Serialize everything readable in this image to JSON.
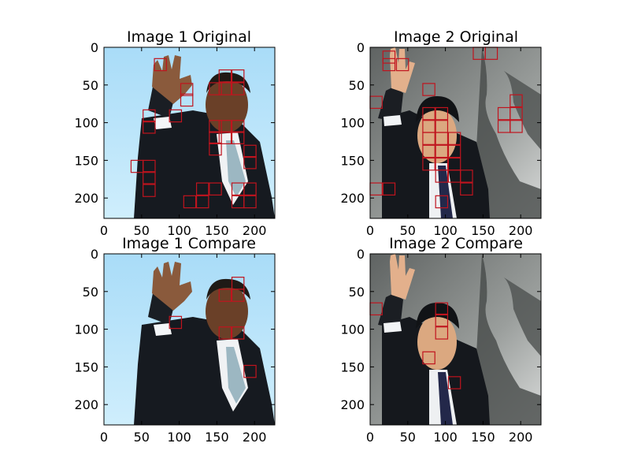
{
  "chart_data": [
    {
      "type": "image",
      "title": "Image 1 Original",
      "xticks": [
        0,
        50,
        100,
        150,
        200
      ],
      "yticks": [
        0,
        50,
        100,
        150,
        200
      ],
      "xlim": [
        0,
        227
      ],
      "ylim": [
        227,
        0
      ],
      "image_subject": "Barack Obama waving, light blue background",
      "background_color": "#bfe6fa",
      "box_color": "#c0141e",
      "box_size": 16,
      "boxes": [
        [
          67,
          15
        ],
        [
          102,
          48
        ],
        [
          102,
          62
        ],
        [
          87,
          83
        ],
        [
          52,
          83
        ],
        [
          52,
          98
        ],
        [
          140,
          47
        ],
        [
          153,
          47
        ],
        [
          170,
          47
        ],
        [
          153,
          30
        ],
        [
          170,
          30
        ],
        [
          140,
          97
        ],
        [
          140,
          112
        ],
        [
          140,
          127
        ],
        [
          153,
          97
        ],
        [
          153,
          112
        ],
        [
          170,
          97
        ],
        [
          170,
          112
        ],
        [
          186,
          130
        ],
        [
          186,
          145
        ],
        [
          36,
          150
        ],
        [
          52,
          150
        ],
        [
          52,
          165
        ],
        [
          52,
          182
        ],
        [
          123,
          180
        ],
        [
          140,
          180
        ],
        [
          123,
          197
        ],
        [
          106,
          197
        ],
        [
          170,
          180
        ],
        [
          186,
          180
        ],
        [
          170,
          197
        ],
        [
          186,
          197
        ]
      ]
    },
    {
      "type": "image",
      "title": "Image 2 Original",
      "xticks": [
        0,
        50,
        100,
        150,
        200
      ],
      "yticks": [
        0,
        50,
        100,
        150,
        200
      ],
      "xlim": [
        0,
        227
      ],
      "ylim": [
        227,
        0
      ],
      "image_subject": "Shinzo Abe waving, grey background with shadow",
      "background_color": "#8e9290",
      "box_color": "#c0141e",
      "box_size": 16,
      "boxes": [
        [
          17,
          5
        ],
        [
          17,
          15
        ],
        [
          35,
          15
        ],
        [
          137,
          0
        ],
        [
          153,
          0
        ],
        [
          0,
          65
        ],
        [
          70,
          48
        ],
        [
          70,
          80
        ],
        [
          70,
          97
        ],
        [
          87,
          80
        ],
        [
          87,
          97
        ],
        [
          70,
          113
        ],
        [
          70,
          130
        ],
        [
          87,
          113
        ],
        [
          87,
          130
        ],
        [
          104,
          113
        ],
        [
          104,
          130
        ],
        [
          70,
          147
        ],
        [
          87,
          147
        ],
        [
          104,
          147
        ],
        [
          104,
          163
        ],
        [
          87,
          163
        ],
        [
          120,
          163
        ],
        [
          120,
          180
        ],
        [
          0,
          180
        ],
        [
          17,
          180
        ],
        [
          87,
          197
        ],
        [
          170,
          80
        ],
        [
          186,
          80
        ],
        [
          170,
          97
        ],
        [
          186,
          97
        ],
        [
          186,
          63
        ]
      ]
    },
    {
      "type": "image",
      "title": "Image 1 Compare",
      "xticks": [
        0,
        50,
        100,
        150,
        200
      ],
      "yticks": [
        0,
        50,
        100,
        150,
        200
      ],
      "xlim": [
        0,
        227
      ],
      "ylim": [
        227,
        0
      ],
      "image_subject": "Barack Obama waving, light blue background",
      "background_color": "#bfe6fa",
      "box_color": "#c0141e",
      "box_size": 16,
      "boxes": [
        [
          153,
          47
        ],
        [
          170,
          47
        ],
        [
          170,
          31
        ],
        [
          87,
          83
        ],
        [
          153,
          97
        ],
        [
          170,
          97
        ],
        [
          186,
          148
        ]
      ]
    },
    {
      "type": "image",
      "title": "Image 2 Compare",
      "xticks": [
        0,
        50,
        100,
        150,
        200
      ],
      "yticks": [
        0,
        50,
        100,
        150,
        200
      ],
      "xlim": [
        0,
        227
      ],
      "ylim": [
        227,
        0
      ],
      "image_subject": "Shinzo Abe waving, grey background with shadow",
      "background_color": "#8e9290",
      "box_color": "#c0141e",
      "box_size": 16,
      "boxes": [
        [
          0,
          65
        ],
        [
          87,
          65
        ],
        [
          87,
          80
        ],
        [
          87,
          97
        ],
        [
          70,
          130
        ],
        [
          104,
          163
        ]
      ]
    }
  ]
}
